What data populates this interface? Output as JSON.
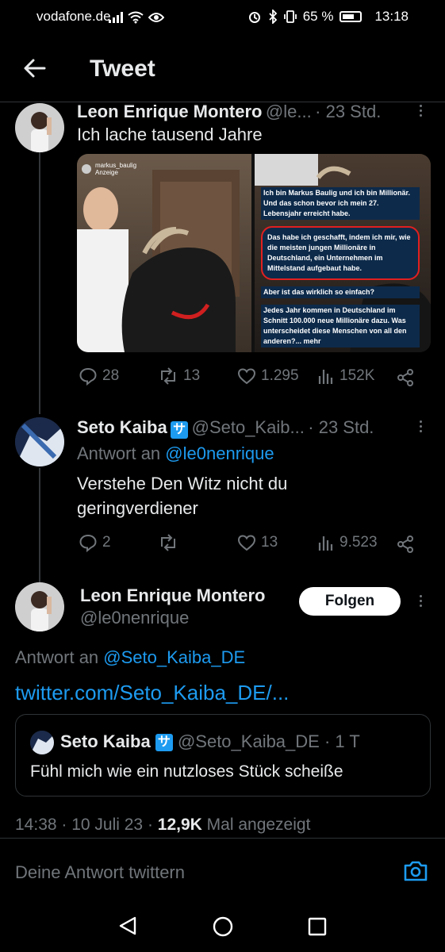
{
  "status_bar": {
    "carrier": "vodafone.de",
    "battery": "65 %",
    "time": "13:18"
  },
  "header": {
    "title": "Tweet"
  },
  "tweet1": {
    "name": "Leon Enrique Montero",
    "handle": "@le...",
    "time": "· 23 Std.",
    "text": "Ich lache tausend Jahre",
    "media": {
      "left_account": "markus_baulig",
      "left_sub": "Anzeige",
      "right_text": [
        "Ich bin Markus Baulig und ich bin Millionär. Und das schon bevor ich mein 27. Lebensjahr erreicht habe.",
        "Das habe ich geschafft, indem ich mir, wie die meisten jungen Millionäre in Deutschland, ein Unternehmen im Mittelstand aufgebaut habe.",
        "Aber ist das wirklich so einfach?",
        "Jedes Jahr kommen in Deutschland im Schnitt 100.000 neue Millionäre dazu. Was unterscheidet diese Menschen von all den anderen?... mehr"
      ]
    },
    "replies": "28",
    "retweets": "13",
    "likes": "1.295",
    "views": "152K"
  },
  "tweet2": {
    "name": "Seto Kaiba",
    "verified_glyph": "サ",
    "handle": "@Seto_Kaib...",
    "time": "· 23 Std.",
    "reply_prefix": "Antwort an",
    "reply_to": "@le0nenrique",
    "text_line1": "Verstehe Den Witz nicht du",
    "text_line2": "geringverdiener",
    "replies": "2",
    "retweets": "",
    "likes": "13",
    "views": "9.523"
  },
  "main_tweet": {
    "name": "Leon Enrique Montero",
    "handle": "@le0nenrique",
    "follow_label": "Folgen",
    "reply_prefix": "Antwort an",
    "reply_to": "@Seto_Kaiba_DE",
    "link": "twitter.com/Seto_Kaiba_DE/...",
    "quote": {
      "name": "Seto Kaiba",
      "verified_glyph": "サ",
      "handle": "@Seto_Kaiba_DE",
      "time": "· 1 T",
      "text": "Fühl mich wie ein nutzloses Stück scheiße"
    },
    "timestamp": "14:38 · 10 Juli 23 ·",
    "views_count": "12,9K",
    "views_label": "Mal angezeigt"
  },
  "reply_bar": {
    "placeholder": "Deine Antwort twittern"
  },
  "colors": {
    "accent": "#1d9bf0",
    "muted": "#71767b",
    "background": "#000000"
  }
}
